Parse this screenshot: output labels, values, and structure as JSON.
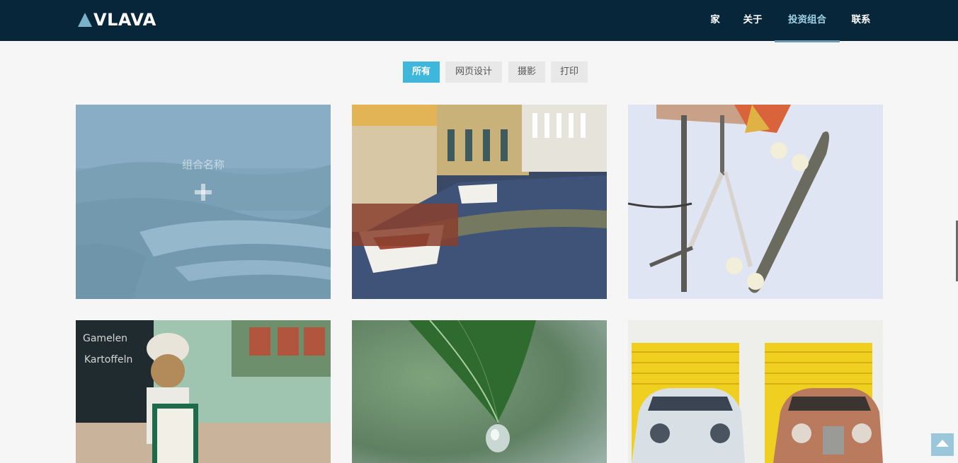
{
  "brand": {
    "name": "VLAVA",
    "icon": "triangle-logo-icon",
    "accent": "#7ab3c9"
  },
  "nav": {
    "background": "#07263a",
    "items": [
      {
        "label": "家"
      },
      {
        "label": "关于"
      },
      {
        "label": "投资组合",
        "active": true
      },
      {
        "label": "联系"
      }
    ]
  },
  "filters": {
    "active_color": "#3fb7dc",
    "items": [
      {
        "label": "所有",
        "active": true
      },
      {
        "label": "网页设计"
      },
      {
        "label": "摄影"
      },
      {
        "label": "打印"
      }
    ]
  },
  "portfolio": {
    "overlay_title": "组合名称",
    "overlay_icon": "plus-icon",
    "items": [
      {
        "image": "foggy-marsh-landscape",
        "hovered": true
      },
      {
        "image": "canal-boats-town"
      },
      {
        "image": "skateboard-and-stool"
      },
      {
        "image": "chef-teddy-bear-shop"
      },
      {
        "image": "leaf-water-drop"
      },
      {
        "image": "vintage-cars-yellow-doors"
      }
    ]
  },
  "back_to_top": {
    "icon": "arrow-up-icon"
  }
}
